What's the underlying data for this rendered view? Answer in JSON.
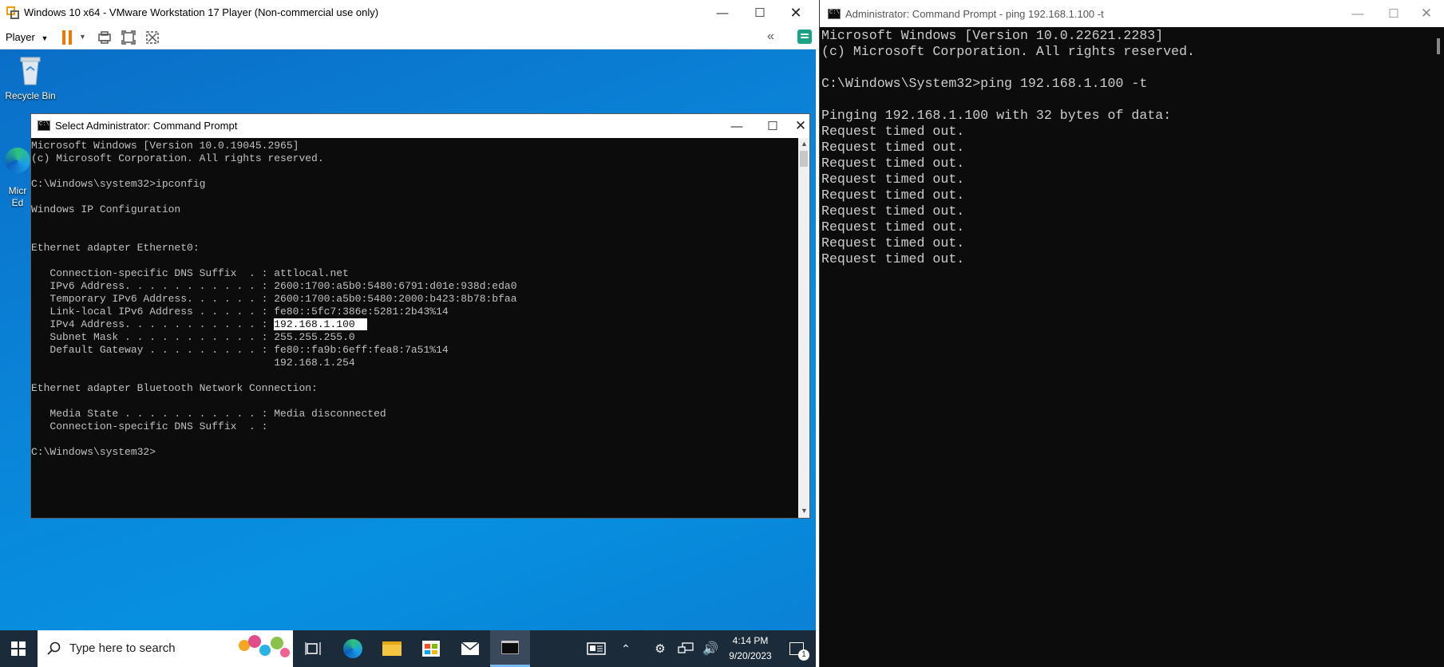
{
  "vmware": {
    "title": "Windows 10 x64 - VMware Workstation 17 Player (Non-commercial use only)",
    "player_menu": "Player"
  },
  "desktop": {
    "recycle_bin_label": "Recycle Bin",
    "edge_label": "Micr\nEd"
  },
  "guest_cmd": {
    "title": "Select Administrator: Command Prompt",
    "lines_before": [
      "Microsoft Windows [Version 10.0.19045.2965]",
      "(c) Microsoft Corporation. All rights reserved.",
      "",
      "C:\\Windows\\system32>ipconfig",
      "",
      "Windows IP Configuration",
      "",
      "",
      "Ethernet adapter Ethernet0:",
      "",
      "   Connection-specific DNS Suffix  . : attlocal.net",
      "   IPv6 Address. . . . . . . . . . . : 2600:1700:a5b0:5480:6791:d01e:938d:eda0",
      "   Temporary IPv6 Address. . . . . . : 2600:1700:a5b0:5480:2000:b423:8b78:bfaa",
      "   Link-local IPv6 Address . . . . . : fe80::5fc7:386e:5281:2b43%14"
    ],
    "ipv4_prefix": "   IPv4 Address. . . . . . . . . . . : ",
    "ipv4_selected": "192.168.1.100  ",
    "lines_after": [
      "   Subnet Mask . . . . . . . . . . . : 255.255.255.0",
      "   Default Gateway . . . . . . . . . : fe80::fa9b:6eff:fea8:7a51%14",
      "                                       192.168.1.254",
      "",
      "Ethernet adapter Bluetooth Network Connection:",
      "",
      "   Media State . . . . . . . . . . . : Media disconnected",
      "   Connection-specific DNS Suffix  . :",
      "",
      "C:\\Windows\\system32>"
    ]
  },
  "taskbar": {
    "search_placeholder": "Type here to search",
    "time": "4:14 PM",
    "date": "9/20/2023",
    "notification_count": "1"
  },
  "host_cmd": {
    "title": "Administrator: Command Prompt - ping  192.168.1.100 -t",
    "lines": [
      "Microsoft Windows [Version 10.0.22621.2283]",
      "(c) Microsoft Corporation. All rights reserved.",
      "",
      "C:\\Windows\\System32>ping 192.168.1.100 -t",
      "",
      "Pinging 192.168.1.100 with 32 bytes of data:",
      "Request timed out.",
      "Request timed out.",
      "Request timed out.",
      "Request timed out.",
      "Request timed out.",
      "Request timed out.",
      "Request timed out.",
      "Request timed out.",
      "Request timed out."
    ]
  },
  "colors": {
    "cmd_bg": "#0c0c0c",
    "cmd_text": "#cccccc",
    "desktop_blue": "#0a84d8",
    "taskbar": "#1c2b3a"
  }
}
